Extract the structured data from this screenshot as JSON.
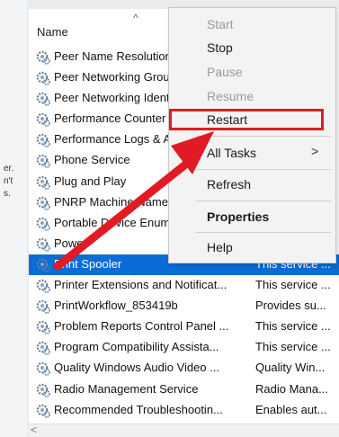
{
  "left_fragments": [
    "er.",
    "n't",
    "s."
  ],
  "header": {
    "col_name": "Name"
  },
  "services": [
    {
      "name": "Peer Name Resolution Protocol",
      "desc": ""
    },
    {
      "name": "Peer Networking Grouping",
      "desc": ""
    },
    {
      "name": "Peer Networking Identity Manager",
      "desc": ""
    },
    {
      "name": "Performance Counter DLL Host",
      "desc": ""
    },
    {
      "name": "Performance Logs & Alerts",
      "desc": ""
    },
    {
      "name": "Phone Service",
      "desc": ""
    },
    {
      "name": "Plug and Play",
      "desc": ""
    },
    {
      "name": "PNRP Machine Name Publication Service",
      "desc": ""
    },
    {
      "name": "Portable Device Enumerator Service",
      "desc": ""
    },
    {
      "name": "Power",
      "desc": ""
    },
    {
      "name": "Print Spooler",
      "desc": "This service ..."
    },
    {
      "name": "Printer Extensions and Notificat...",
      "desc": "This service ..."
    },
    {
      "name": "PrintWorkflow_853419b",
      "desc": "Provides su..."
    },
    {
      "name": "Problem Reports Control Panel ...",
      "desc": "This service ..."
    },
    {
      "name": "Program Compatibility Assista...",
      "desc": "This service ..."
    },
    {
      "name": "Quality Windows Audio Video ...",
      "desc": "Quality Win..."
    },
    {
      "name": "Radio Management Service",
      "desc": "Radio Mana..."
    },
    {
      "name": "Recommended Troubleshootin...",
      "desc": "Enables aut..."
    }
  ],
  "menu": {
    "start": "Start",
    "stop": "Stop",
    "pause": "Pause",
    "resume": "Resume",
    "restart": "Restart",
    "all_tasks": "All Tasks",
    "submenu_arrow": ">",
    "refresh": "Refresh",
    "properties": "Properties",
    "help": "Help"
  },
  "colors": {
    "selection": "#0a6cd6",
    "highlight": "#e01b24",
    "arrow": "#e01b24"
  },
  "icons": {
    "row_icon": "service-gear-icon",
    "sort": "sort-up-icon",
    "scroll": "scroll-left-icon"
  }
}
